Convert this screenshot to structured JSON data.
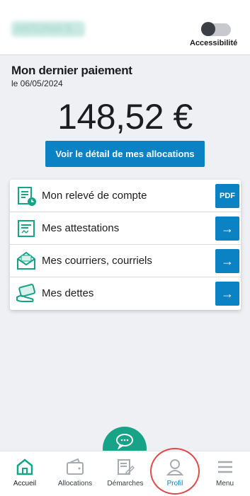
{
  "header": {
    "user_name": "ANTONIA S.",
    "accessibility_label": "Accessibilité"
  },
  "payment": {
    "title": "Mon dernier paiement",
    "date": "le 06/05/2024",
    "amount": "148,52 €",
    "detail_button": "Voir le détail de mes allocations"
  },
  "menu": [
    {
      "label": "Mon relevé de compte",
      "action": "PDF",
      "icon": "document-clock-icon"
    },
    {
      "label": "Mes attestations",
      "action": "→",
      "icon": "certificate-icon"
    },
    {
      "label": "Mes courriers, courriels",
      "action": "→",
      "icon": "envelope-icon"
    },
    {
      "label": "Mes dettes",
      "action": "→",
      "icon": "card-hand-icon"
    }
  ],
  "nav": {
    "accueil": "Accueil",
    "allocations": "Allocations",
    "demarches": "Démarches",
    "profil": "Profil",
    "menu": "Menu"
  },
  "colors": {
    "accent_blue": "#0a82c4",
    "accent_green": "#17a387",
    "highlight_red": "#e04b4b"
  }
}
